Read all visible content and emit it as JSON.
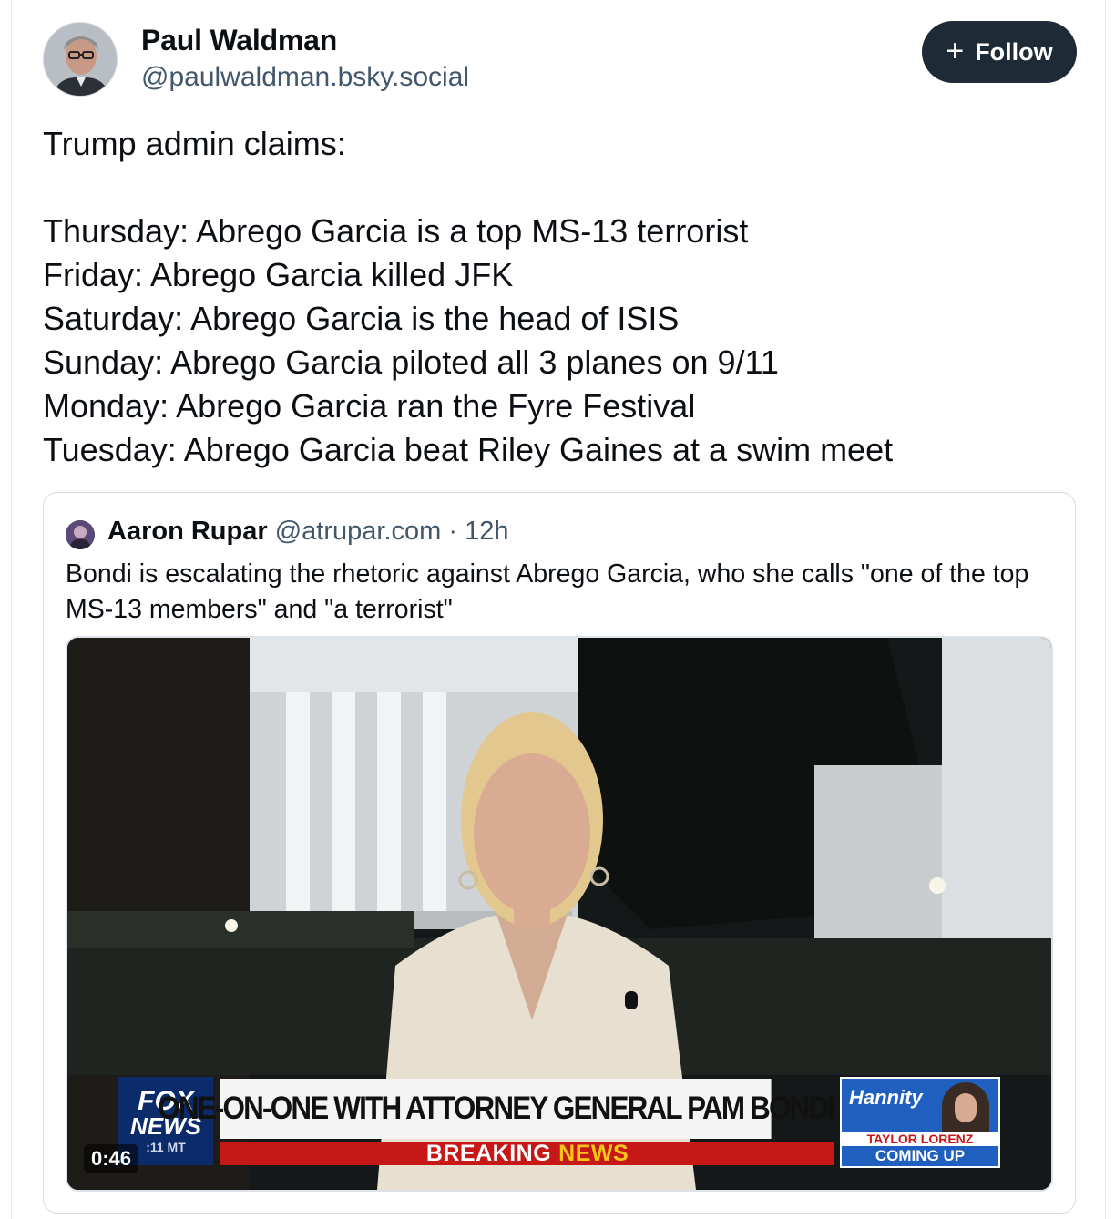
{
  "post": {
    "author": {
      "name": "Paul Waldman",
      "handle": "@paulwaldman.bsky.social",
      "avatar_icon": "user-avatar-icon"
    },
    "follow_button": {
      "icon": "plus-icon",
      "label": "Follow"
    },
    "text_lines": [
      "Trump admin claims:",
      "",
      "Thursday: Abrego Garcia is a top MS-13 terrorist",
      "Friday: Abrego Garcia killed JFK",
      "Saturday: Abrego Garcia is the head of ISIS",
      "Sunday: Abrego Garcia piloted all 3 planes on 9/11",
      "Monday: Abrego Garcia ran the Fyre Festival",
      "Tuesday: Abrego Garcia beat Riley Gaines at a swim meet"
    ]
  },
  "quote": {
    "author": {
      "name": "Aaron Rupar",
      "handle": "@atrupar.com",
      "age": "12h",
      "separator": "·"
    },
    "text": "Bondi is escalating the rhetoric against Abrego Garcia, who she calls \"one of the top MS-13 members\" and \"a terrorist\"",
    "video": {
      "timestamp": "0:46",
      "network_logo": {
        "line1": "FOX",
        "line2": "NEWS",
        "clock": ":11 MT"
      },
      "headline": "ONE-ON-ONE WITH ATTORNEY GENERAL PAM BONDI",
      "ticker": {
        "part1": "BREAKING",
        "part2": "NEWS"
      },
      "promo": {
        "show": "Hannity",
        "guest": "TAYLOR LORENZ",
        "status": "COMING UP"
      }
    }
  },
  "colors": {
    "text": "#0b0f14",
    "secondary_text": "#42576c",
    "follow_button_bg": "#1f2a37",
    "border": "#d4dbe2"
  }
}
